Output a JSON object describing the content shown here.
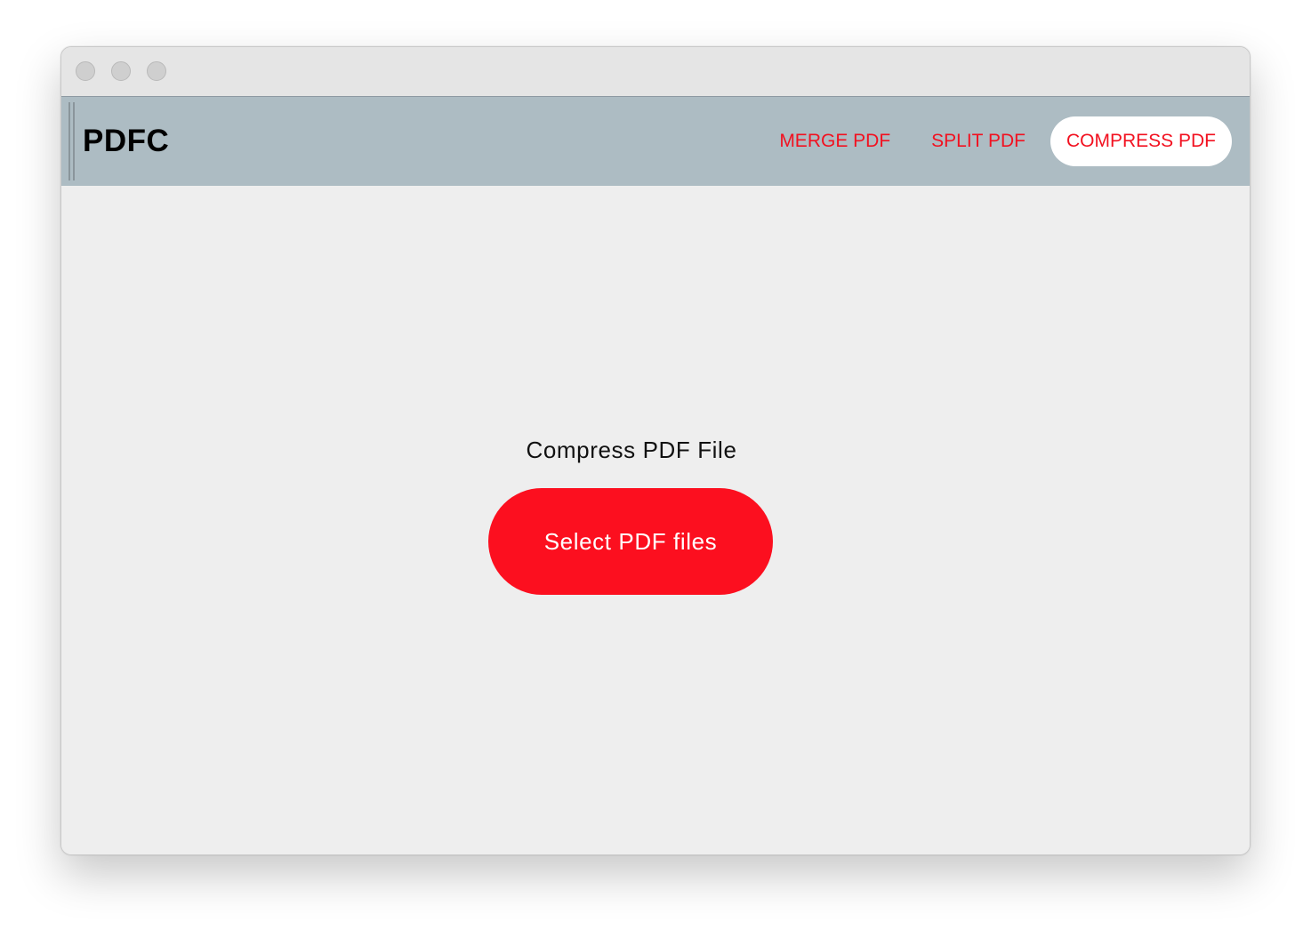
{
  "app": {
    "brand": "PDFC"
  },
  "nav": {
    "items": [
      {
        "label": "MERGE PDF",
        "active": false
      },
      {
        "label": "SPLIT PDF",
        "active": false
      },
      {
        "label": "COMPRESS PDF",
        "active": true
      }
    ]
  },
  "main": {
    "heading": "Compress PDF File",
    "select_button_label": "Select PDF files"
  },
  "colors": {
    "accent": "#fc0f1f",
    "nav_text": "#f21120",
    "navbar_bg": "#adbcc3",
    "content_bg": "#eeeeee"
  }
}
